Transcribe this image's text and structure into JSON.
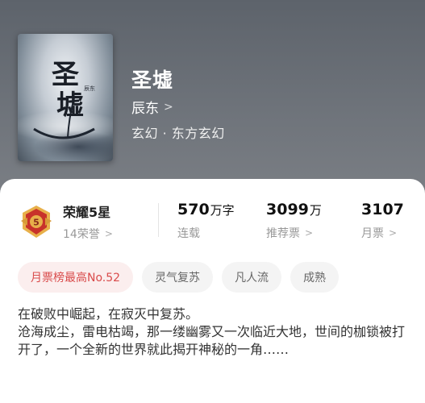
{
  "book": {
    "title": "圣墟",
    "author": "辰东",
    "genre": "玄幻 · 东方玄幻",
    "cover_calligraphy": "圣墟",
    "cover_byline": "辰东"
  },
  "honor": {
    "name": "荣耀5星",
    "badge_level": "5",
    "count": "14荣誉"
  },
  "stats": [
    {
      "value": "570",
      "unit": "万字",
      "label": "连载"
    },
    {
      "value": "3099",
      "unit": "万",
      "label": "推荐票"
    },
    {
      "value": "3107",
      "unit": "",
      "label": "月票"
    }
  ],
  "tags": [
    "月票榜最高No.52",
    "灵气复苏",
    "凡人流",
    "成熟"
  ],
  "description": [
    "在破败中崛起，在寂灭中复苏。",
    "沧海成尘，雷电枯竭，那一缕幽雾又一次临近大地，世间的枷锁被打开了，一个全新的世界就此揭开神秘的一角……"
  ],
  "colors": {
    "hero_bg": "#6b7078",
    "hot_tag_text": "#d94b4b",
    "hot_tag_bg": "#fbeeee",
    "badge_red": "#c8322a",
    "badge_gold": "#e8b04a"
  },
  "icons": {
    "chevron": "chevron-right-icon",
    "badge": "honor-badge-icon"
  }
}
